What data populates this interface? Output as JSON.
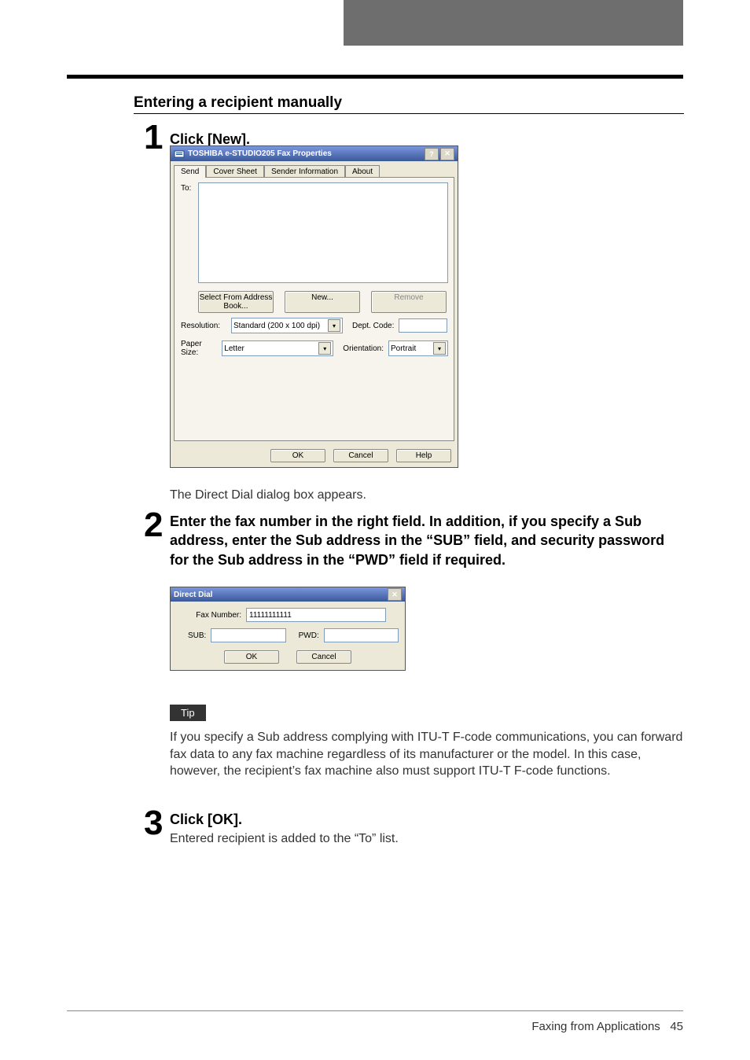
{
  "section_title": "Entering a recipient manually",
  "step1": {
    "num": "1",
    "heading": "Click [New].",
    "caption": "The Direct Dial dialog box appears."
  },
  "dlg1": {
    "title": "TOSHIBA e-STUDIO205 Fax Properties",
    "help_btn": "?",
    "close_btn": "✕",
    "tabs": [
      "Send",
      "Cover Sheet",
      "Sender Information",
      "About"
    ],
    "to_label": "To:",
    "btn_select": "Select From Address Book...",
    "btn_new": "New...",
    "btn_remove": "Remove",
    "res_label": "Resolution:",
    "res_value": "Standard (200 x 100 dpi)",
    "dept_label": "Dept. Code:",
    "paper_label": "Paper Size:",
    "paper_value": "Letter",
    "orient_label": "Orientation:",
    "orient_value": "Portrait",
    "ok": "OK",
    "cancel": "Cancel",
    "help": "Help"
  },
  "step2": {
    "num": "2",
    "heading": "Enter the fax number in the right field. In addition, if you specify a Sub address, enter the Sub address in the “SUB” field, and security password for the Sub address in the “PWD” field if required."
  },
  "dlg2": {
    "title": "Direct Dial",
    "close_btn": "✕",
    "fax_label": "Fax Number:",
    "fax_value": "11111111111",
    "sub_label": "SUB:",
    "pwd_label": "PWD:",
    "ok": "OK",
    "cancel": "Cancel"
  },
  "tip": {
    "label": "Tip",
    "text": "If you specify a Sub address complying with ITU-T F-code communications, you can forward fax data to any fax machine regardless of its manufacturer or the model. In this case, however, the recipient’s fax machine also must support ITU-T F-code functions."
  },
  "step3": {
    "num": "3",
    "heading": "Click [OK].",
    "caption": "Entered recipient is added to the “To” list."
  },
  "footer": {
    "section": "Faxing from Applications",
    "page": "45"
  }
}
